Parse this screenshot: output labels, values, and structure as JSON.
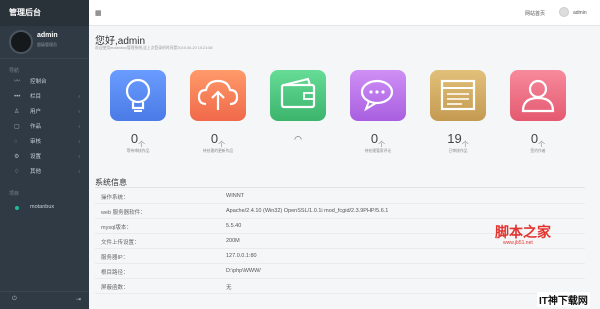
{
  "sidebar": {
    "brand": "管理后台",
    "user_name": "admin",
    "user_role": "超级管理员",
    "section_nav": "导航",
    "items": [
      {
        "icon": "chart-line-icon",
        "glyph": "〰",
        "label": "控制台",
        "chev": ""
      },
      {
        "icon": "dots-icon",
        "glyph": "•••",
        "label": "栏目",
        "chev": "‹"
      },
      {
        "icon": "user-icon",
        "glyph": "♙",
        "label": "用户",
        "chev": "‹"
      },
      {
        "icon": "doc-icon",
        "glyph": "▢",
        "label": "作品",
        "chev": "‹"
      },
      {
        "icon": "spinner-icon",
        "glyph": "◌",
        "label": "审核",
        "chev": "‹"
      },
      {
        "icon": "gear-icon",
        "glyph": "⚙",
        "label": "设置",
        "chev": "‹"
      },
      {
        "icon": "bulb-icon",
        "glyph": "♢",
        "label": "其他",
        "chev": "‹"
      }
    ],
    "section_project": "项目",
    "project_item": "motanbux",
    "bottom_left_icon": "power-icon",
    "bottom_right_icon": "logout-icon"
  },
  "topbar": {
    "site_link": "网站首页",
    "user": "admin"
  },
  "main": {
    "greeting": "您好,admin",
    "subtitle": "欢迎使用motanbox管理系统,这上次登录的时间是2019-06-20 10:21:58"
  },
  "cards": [
    {
      "name": "bulb",
      "color": "#5b8ff9",
      "color2": "#4a7be6",
      "count": "0",
      "unit": "个",
      "label": "等待审核作品"
    },
    {
      "name": "upload",
      "color": "#ff8a5b",
      "color2": "#f0694a",
      "count": "0",
      "unit": "个",
      "label": "待处理的更新作品"
    },
    {
      "name": "wallet",
      "color": "#57d188",
      "color2": "#3cb46c",
      "count": "",
      "unit": "",
      "label": ""
    },
    {
      "name": "chat",
      "color": "#c57df0",
      "color2": "#a95fe0",
      "count": "0",
      "unit": "个",
      "label": "待处理管家评论"
    },
    {
      "name": "browser",
      "color": "#d9b46a",
      "color2": "#c49a50",
      "count": "19",
      "unit": "个",
      "label": "已审核作品"
    },
    {
      "name": "user",
      "color": "#f2768a",
      "color2": "#e45a70",
      "count": "0",
      "unit": "个",
      "label": "签约作者"
    }
  ],
  "info": {
    "title": "系统信息",
    "rows": [
      {
        "k": "操作系统：",
        "v": "WINNT"
      },
      {
        "k": "web 服务器软件：",
        "v": "Apache/2.4.10 (Win32) OpenSSL/1.0.1i mod_fcgid/2.3.9PHP/5.6.1"
      },
      {
        "k": "mysql版本：",
        "v": "5.5.40"
      },
      {
        "k": "文件上传设置：",
        "v": "200M"
      },
      {
        "k": "服务器IP：",
        "v": "127.0.0.1:80"
      },
      {
        "k": "根目路径：",
        "v": "D:\\php\\WWW/"
      },
      {
        "k": "屏蔽函数：",
        "v": "无"
      }
    ]
  },
  "watermark": {
    "site_cn": "脚本之家",
    "site_url": "www.jb51.net",
    "corner": "IT神下载网"
  }
}
